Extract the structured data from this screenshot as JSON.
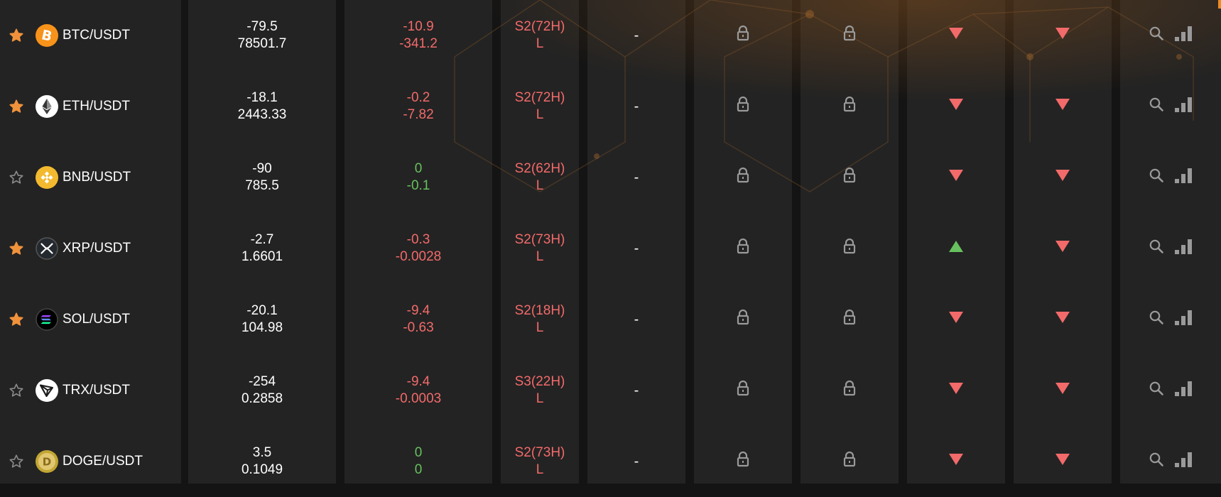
{
  "colors": {
    "up": "#67c15e",
    "down": "#f36a6a",
    "star_on": "#f0923b",
    "star_off": "#8a8a8a",
    "icon_gray": "#9a9a9a",
    "cell_bg": "#232323",
    "gap_bg": "#141414"
  },
  "rows": [
    {
      "favorite": true,
      "coin_icon": "bitcoin-icon",
      "coin_color": "#f7931a",
      "pair": "BTC/USDT",
      "change": "-79.5",
      "price": "78501.7",
      "delta_a": "-10.9",
      "delta_b": "-341.2",
      "delta_color": "down",
      "signal": "S2(72H)",
      "signal_side": "L",
      "extra": "-",
      "trend_a": "down",
      "trend_b": "down"
    },
    {
      "favorite": true,
      "coin_icon": "ethereum-icon",
      "coin_color": "#ffffff",
      "pair": "ETH/USDT",
      "change": "-18.1",
      "price": "2443.33",
      "delta_a": "-0.2",
      "delta_b": "-7.82",
      "delta_color": "down",
      "signal": "S2(72H)",
      "signal_side": "L",
      "extra": "-",
      "trend_a": "down",
      "trend_b": "down"
    },
    {
      "favorite": false,
      "coin_icon": "bnb-icon",
      "coin_color": "#f3ba2f",
      "pair": "BNB/USDT",
      "change": "-90",
      "price": "785.5",
      "delta_a": "0",
      "delta_b": "-0.1",
      "delta_color": "up",
      "signal": "S2(62H)",
      "signal_side": "L",
      "extra": "-",
      "trend_a": "down",
      "trend_b": "down"
    },
    {
      "favorite": true,
      "coin_icon": "xrp-icon",
      "coin_color": "#23292f",
      "pair": "XRP/USDT",
      "change": "-2.7",
      "price": "1.6601",
      "delta_a": "-0.3",
      "delta_b": "-0.0028",
      "delta_color": "down",
      "signal": "S2(73H)",
      "signal_side": "L",
      "extra": "-",
      "trend_a": "up",
      "trend_b": "down"
    },
    {
      "favorite": true,
      "coin_icon": "solana-icon",
      "coin_color": "#000000",
      "pair": "SOL/USDT",
      "change": "-20.1",
      "price": "104.98",
      "delta_a": "-9.4",
      "delta_b": "-0.63",
      "delta_color": "down",
      "signal": "S2(18H)",
      "signal_side": "L",
      "extra": "-",
      "trend_a": "down",
      "trend_b": "down"
    },
    {
      "favorite": false,
      "coin_icon": "tron-icon",
      "coin_color": "#ffffff",
      "pair": "TRX/USDT",
      "change": "-254",
      "price": "0.2858",
      "delta_a": "-9.4",
      "delta_b": "-0.0003",
      "delta_color": "down",
      "signal": "S3(22H)",
      "signal_side": "L",
      "extra": "-",
      "trend_a": "down",
      "trend_b": "down"
    },
    {
      "favorite": false,
      "coin_icon": "dogecoin-icon",
      "coin_color": "#c2a633",
      "pair": "DOGE/USDT",
      "change": "3.5",
      "price": "0.1049",
      "delta_a": "0",
      "delta_b": "0",
      "delta_color": "up",
      "signal": "S2(73H)",
      "signal_side": "L",
      "extra": "-",
      "trend_a": "down",
      "trend_b": "down"
    }
  ]
}
